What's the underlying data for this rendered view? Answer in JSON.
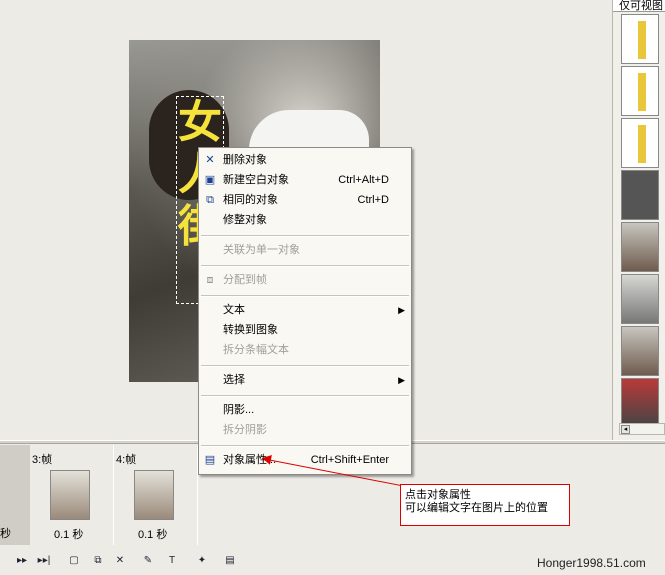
{
  "image": {
    "overlay_text": "女人街"
  },
  "right_panel": {
    "header": "仅可视图"
  },
  "context_menu": {
    "items": [
      {
        "label": "删除对象",
        "shortcut": "",
        "icon": "x-icon",
        "disabled": false
      },
      {
        "label": "新建空白对象",
        "shortcut": "Ctrl+Alt+D",
        "icon": "new-object-icon",
        "disabled": false
      },
      {
        "label": "相同的对象",
        "shortcut": "Ctrl+D",
        "icon": "duplicate-icon",
        "disabled": false
      },
      {
        "label": "修整对象",
        "shortcut": "",
        "icon": "",
        "disabled": false
      },
      {
        "label": "关联为单一对象",
        "shortcut": "",
        "icon": "",
        "disabled": true
      },
      {
        "label": "分配到帧",
        "shortcut": "",
        "icon": "distribute-icon",
        "disabled": true
      },
      {
        "label": "文本",
        "shortcut": "",
        "icon": "",
        "disabled": false,
        "submenu": true
      },
      {
        "label": "转换到图象",
        "shortcut": "",
        "icon": "",
        "disabled": false
      },
      {
        "label": "拆分条幅文本",
        "shortcut": "",
        "icon": "",
        "disabled": true
      },
      {
        "label": "选择",
        "shortcut": "",
        "icon": "",
        "disabled": false,
        "submenu": true
      },
      {
        "label": "阴影...",
        "shortcut": "",
        "icon": "",
        "disabled": false
      },
      {
        "label": "拆分阴影",
        "shortcut": "",
        "icon": "",
        "disabled": true
      },
      {
        "label": "对象属性...",
        "shortcut": "Ctrl+Shift+Enter",
        "icon": "properties-icon",
        "disabled": false
      }
    ]
  },
  "frames": [
    {
      "label": "3:帧",
      "time": "0.1 秒"
    },
    {
      "label": "4:帧",
      "time": "0.1 秒"
    }
  ],
  "annotation": {
    "line1": "点击对象属性",
    "line2": "可以编辑文字在图片上的位置"
  },
  "watermark": "Honger1998.51.com"
}
